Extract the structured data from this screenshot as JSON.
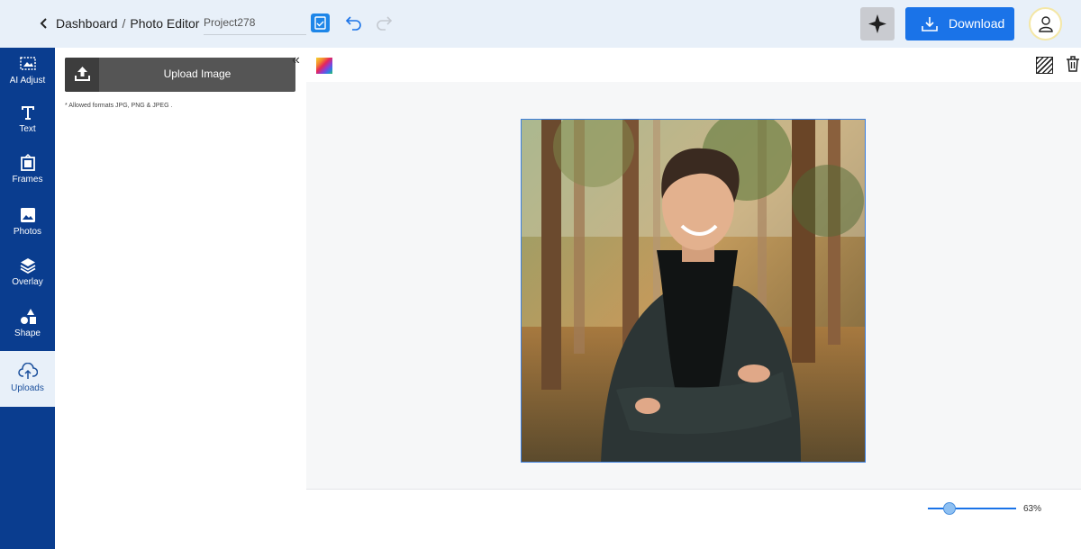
{
  "header": {
    "breadcrumb": [
      "Dashboard",
      "Photo Editor"
    ],
    "breadcrumb_sep": "/",
    "project_name": "Project278",
    "download_label": "Download"
  },
  "nav": {
    "items": [
      {
        "label": "AI Adjust",
        "icon": "ai-adjust-icon"
      },
      {
        "label": "Text",
        "icon": "text-icon"
      },
      {
        "label": "Frames",
        "icon": "frames-icon"
      },
      {
        "label": "Photos",
        "icon": "photos-icon"
      },
      {
        "label": "Overlay",
        "icon": "overlay-icon"
      },
      {
        "label": "Shape",
        "icon": "shape-icon"
      },
      {
        "label": "Uploads",
        "icon": "uploads-icon"
      }
    ],
    "active": "Uploads"
  },
  "panel": {
    "upload_label": "Upload Image",
    "formats_note": "* Allowed formats JPG, PNG & JPEG ."
  },
  "canvas": {
    "zoom": "63%",
    "zoom_fraction": 0.25
  },
  "colors": {
    "accent": "#1a73e8",
    "nav_bg": "#0a3d8f",
    "topbar_bg": "#e8f0f9"
  }
}
